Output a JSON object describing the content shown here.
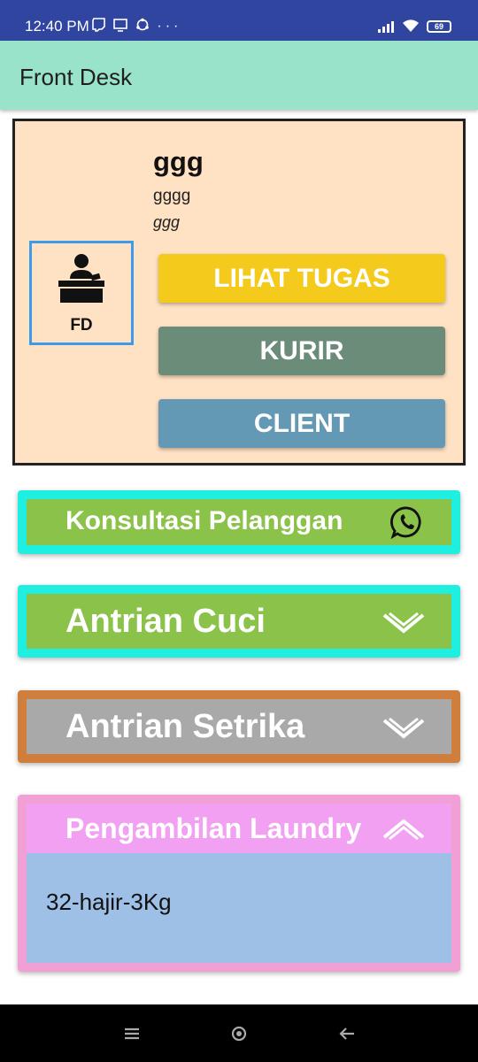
{
  "status": {
    "time": "12:40 PM",
    "left_icons": [
      "twitch-icon",
      "screen-icon",
      "sync-icon",
      "more-icon"
    ],
    "right_icons": [
      "signal-icon",
      "wifi-icon",
      "battery-icon"
    ],
    "battery": "69"
  },
  "app_bar": {
    "title": "Front Desk"
  },
  "profile": {
    "avatar_label": "FD",
    "name": "ggg",
    "subtitle": "gggg",
    "detail": "ggg",
    "buttons": {
      "tugas": "LIHAT TUGAS",
      "kurir": "KURIR",
      "client": "CLIENT"
    },
    "colors": {
      "card_bg": "#ffe1c3",
      "tugas": "#f4cb1d",
      "kurir": "#6b8c78",
      "client": "#6399b5"
    }
  },
  "sections": {
    "konsultasi": {
      "title": "Konsultasi Pelanggan",
      "icon": "whatsapp-icon"
    },
    "cuci": {
      "title": "Antrian Cuci",
      "icon": "chevron-down-icon"
    },
    "setrika": {
      "title": "Antrian Setrika",
      "icon": "chevron-down-icon"
    },
    "pengambilan": {
      "title": "Pengambilan Laundry",
      "icon": "chevron-up-icon",
      "items": [
        "32-hajir-3Kg"
      ]
    }
  },
  "nav": {
    "icons": [
      "menu-icon",
      "home-icon",
      "back-icon"
    ]
  }
}
